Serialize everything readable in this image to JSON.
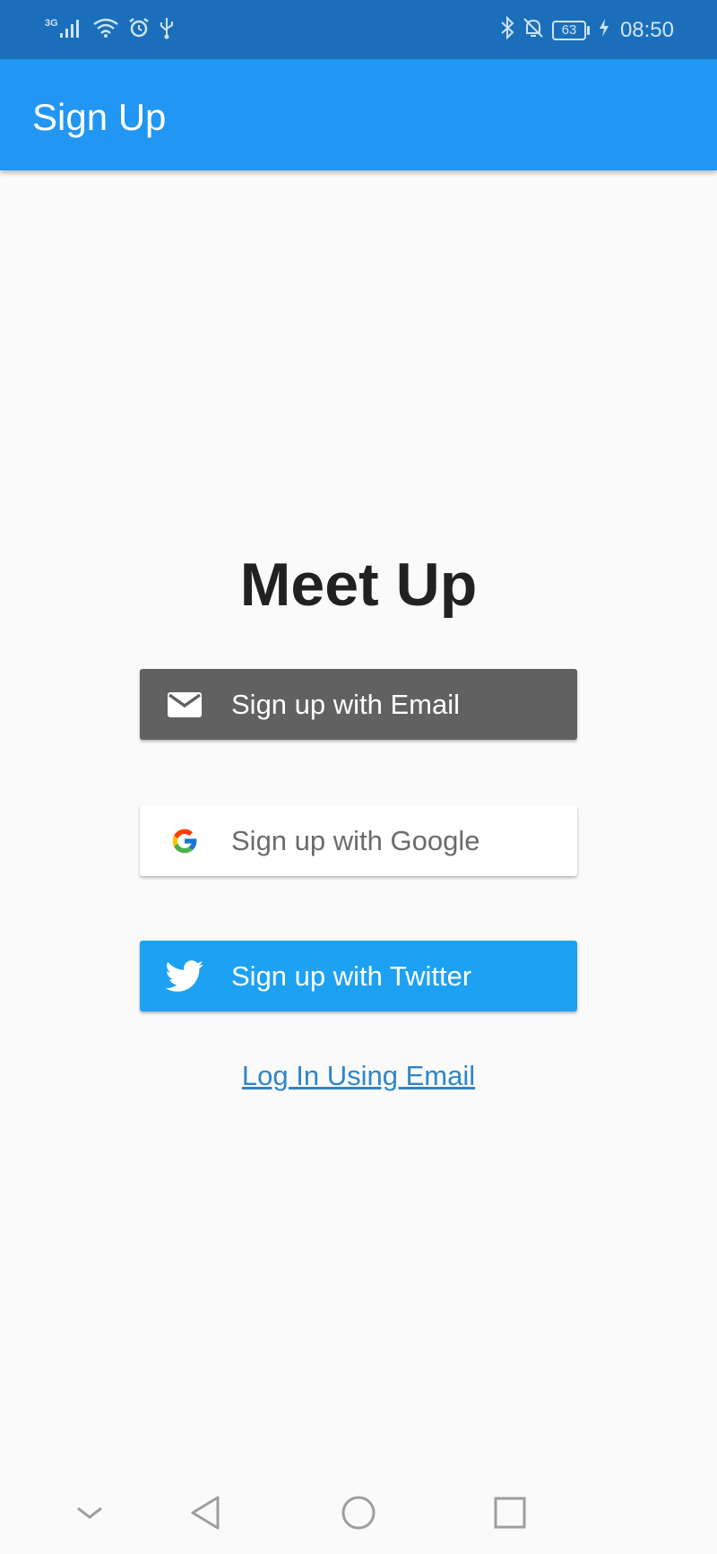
{
  "status_bar": {
    "network_type": "3G",
    "battery_level": "63",
    "time": "08:50",
    "icons_left": [
      "signal-icon",
      "wifi-icon",
      "alarm-icon",
      "usb-icon"
    ],
    "icons_right": [
      "bluetooth-icon",
      "notifications-off-icon",
      "battery-icon",
      "charging-icon"
    ]
  },
  "app_bar": {
    "title": "Sign Up",
    "color": "#2196f3"
  },
  "main": {
    "title": "Meet Up",
    "buttons": [
      {
        "label": "Sign up with Email",
        "icon": "email-icon",
        "color": "#616161"
      },
      {
        "label": "Sign up with Google",
        "icon": "google-icon",
        "color": "#ffffff"
      },
      {
        "label": "Sign up with Twitter",
        "icon": "twitter-icon",
        "color": "#1da1f2"
      }
    ],
    "login_link": "Log In Using Email"
  },
  "nav_bar": {
    "buttons": [
      "hide-keyboard-icon",
      "back-icon",
      "home-icon",
      "recents-icon"
    ]
  }
}
